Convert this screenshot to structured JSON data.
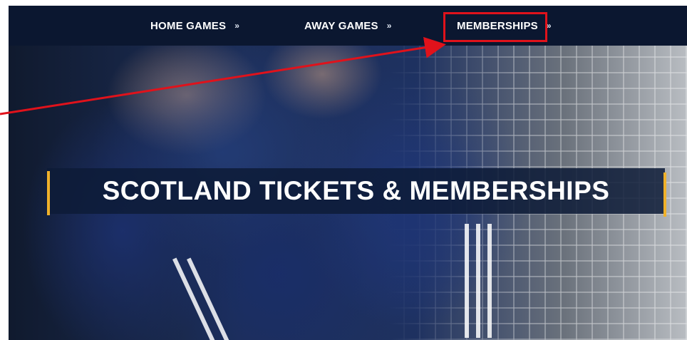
{
  "nav": {
    "items": [
      {
        "label": "HOME GAMES",
        "chevron": "double-chevron-down-icon"
      },
      {
        "label": "AWAY GAMES",
        "chevron": "double-chevron-down-icon"
      },
      {
        "label": "MEMBERSHIPS",
        "chevron": "double-chevron-down-icon"
      }
    ],
    "highlighted": "MEMBERSHIPS"
  },
  "hero": {
    "title": "SCOTLAND TICKETS & MEMBERSHIPS"
  },
  "colors": {
    "navbar": "#0b1730",
    "banner": "#0d1b37",
    "accent": "#f0b12a",
    "highlight": "#e0121b"
  }
}
